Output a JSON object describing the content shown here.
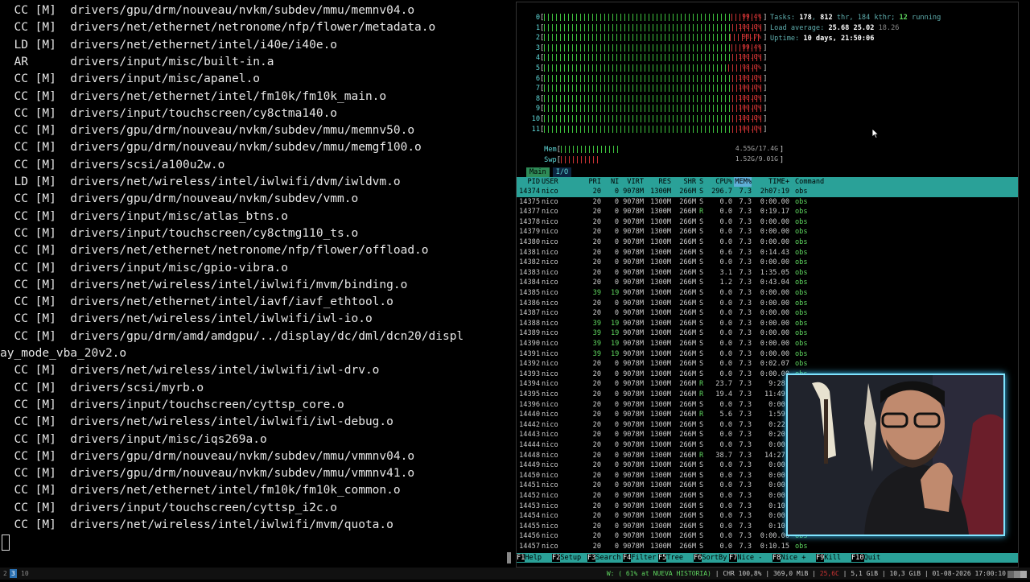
{
  "terminal": {
    "lines": [
      "  CC [M]  drivers/gpu/drm/nouveau/nvkm/subdev/mmu/memnv04.o",
      "  CC [M]  drivers/net/ethernet/netronome/nfp/flower/metadata.o",
      "  LD [M]  drivers/net/ethernet/intel/i40e/i40e.o",
      "  AR      drivers/input/misc/built-in.a",
      "  CC [M]  drivers/input/misc/apanel.o",
      "  CC [M]  drivers/net/ethernet/intel/fm10k/fm10k_main.o",
      "  CC [M]  drivers/input/touchscreen/cy8ctma140.o",
      "  CC [M]  drivers/gpu/drm/nouveau/nvkm/subdev/mmu/memnv50.o",
      "  CC [M]  drivers/gpu/drm/nouveau/nvkm/subdev/mmu/memgf100.o",
      "  CC [M]  drivers/scsi/a100u2w.o",
      "  LD [M]  drivers/net/wireless/intel/iwlwifi/dvm/iwldvm.o",
      "  CC [M]  drivers/gpu/drm/nouveau/nvkm/subdev/vmm.o",
      "  CC [M]  drivers/input/misc/atlas_btns.o",
      "  CC [M]  drivers/input/touchscreen/cy8ctmg110_ts.o",
      "  CC [M]  drivers/net/ethernet/netronome/nfp/flower/offload.o",
      "  CC [M]  drivers/input/misc/gpio-vibra.o",
      "  CC [M]  drivers/net/wireless/intel/iwlwifi/mvm/binding.o",
      "  CC [M]  drivers/net/ethernet/intel/iavf/iavf_ethtool.o",
      "  CC [M]  drivers/net/wireless/intel/iwlwifi/iwl-io.o",
      "  CC [M]  drivers/gpu/drm/amd/amdgpu/../display/dc/dml/dcn20/displ",
      "ay_mode_vba_20v2.o",
      "  CC [M]  drivers/net/wireless/intel/iwlwifi/iwl-drv.o",
      "  CC [M]  drivers/scsi/myrb.o",
      "  CC [M]  drivers/input/touchscreen/cyttsp_core.o",
      "  CC [M]  drivers/net/wireless/intel/iwlwifi/iwl-debug.o",
      "  CC [M]  drivers/input/misc/iqs269a.o",
      "  CC [M]  drivers/gpu/drm/nouveau/nvkm/subdev/mmu/vmmnv04.o",
      "  CC [M]  drivers/gpu/drm/nouveau/nvkm/subdev/mmu/vmmnv41.o",
      "  CC [M]  drivers/net/ethernet/intel/fm10k/fm10k_common.o",
      "  CC [M]  drivers/input/touchscreen/cyttsp_i2c.o",
      "  CC [M]  drivers/net/wireless/intel/iwlwifi/mvm/quota.o"
    ]
  },
  "htop": {
    "cpus": [
      {
        "idx": "0",
        "pct": "99.4%",
        "val": 99.4
      },
      {
        "idx": "1",
        "pct": "100.0%",
        "val": 100
      },
      {
        "idx": "2",
        "pct": "98.7%",
        "val": 98.7
      },
      {
        "idx": "3",
        "pct": "99.4%",
        "val": 99.4
      },
      {
        "idx": "4",
        "pct": "100.0%",
        "val": 100
      },
      {
        "idx": "5",
        "pct": "98.0%",
        "val": 98
      },
      {
        "idx": "6",
        "pct": "100.0%",
        "val": 100
      },
      {
        "idx": "7",
        "pct": "100.0%",
        "val": 100
      },
      {
        "idx": "8",
        "pct": "100.0%",
        "val": 100
      },
      {
        "idx": "9",
        "pct": "100.0%",
        "val": 100
      },
      {
        "idx": "10",
        "pct": "100.0%",
        "val": 100
      },
      {
        "idx": "11",
        "pct": "100.0%",
        "val": 100
      }
    ],
    "mem": {
      "label": "Mem",
      "value": "4.55G/17.4G",
      "fraction": 0.26
    },
    "swp": {
      "label": "Swp",
      "value": "1.52G/9.01G",
      "fraction": 0.17
    },
    "tasks": {
      "label": "Tasks:",
      "count": "178",
      "thr_val": "812",
      "thr_label": "thr,",
      "kthr": "184 kthr;",
      "running": "12",
      "running_label": "running"
    },
    "load": {
      "label": "Load average:",
      "v1": "25.68",
      "v5": "25.02",
      "v15": "18.26"
    },
    "uptime": {
      "label": "Uptime:",
      "value": "10 days, 21:50:06"
    },
    "tabs": [
      "Main",
      "I/O"
    ],
    "columns": [
      "PID",
      "USER",
      "PRI",
      "NI",
      "VIRT",
      "RES",
      "SHR",
      "S",
      "CPU%",
      "MEM%",
      "TIME+",
      "Command"
    ],
    "processes": [
      [
        "14374",
        "nico",
        "20",
        "0",
        "9078M",
        "1300M",
        "266M",
        "S",
        "296.7",
        "7.3",
        "2h07:19",
        "obs"
      ],
      [
        "14375",
        "nico",
        "20",
        "0",
        "9078M",
        "1300M",
        "266M",
        "S",
        "0.0",
        "7.3",
        "0:00.00",
        "obs"
      ],
      [
        "14377",
        "nico",
        "20",
        "0",
        "9078M",
        "1300M",
        "266M",
        "R",
        "0.0",
        "7.3",
        "0:19.17",
        "obs"
      ],
      [
        "14378",
        "nico",
        "20",
        "0",
        "9078M",
        "1300M",
        "266M",
        "S",
        "0.0",
        "7.3",
        "0:00.00",
        "obs"
      ],
      [
        "14379",
        "nico",
        "20",
        "0",
        "9078M",
        "1300M",
        "266M",
        "S",
        "0.0",
        "7.3",
        "0:00.00",
        "obs"
      ],
      [
        "14380",
        "nico",
        "20",
        "0",
        "9078M",
        "1300M",
        "266M",
        "S",
        "0.0",
        "7.3",
        "0:00.00",
        "obs"
      ],
      [
        "14381",
        "nico",
        "20",
        "0",
        "9078M",
        "1300M",
        "266M",
        "S",
        "0.6",
        "7.3",
        "0:14.43",
        "obs"
      ],
      [
        "14382",
        "nico",
        "20",
        "0",
        "9078M",
        "1300M",
        "266M",
        "S",
        "0.0",
        "7.3",
        "0:00.00",
        "obs"
      ],
      [
        "14383",
        "nico",
        "20",
        "0",
        "9078M",
        "1300M",
        "266M",
        "S",
        "3.1",
        "7.3",
        "1:35.05",
        "obs"
      ],
      [
        "14384",
        "nico",
        "20",
        "0",
        "9078M",
        "1300M",
        "266M",
        "S",
        "1.2",
        "7.3",
        "0:43.04",
        "obs"
      ],
      [
        "14385",
        "nico",
        "39",
        "19",
        "9078M",
        "1300M",
        "266M",
        "S",
        "0.0",
        "7.3",
        "0:00.00",
        "obs"
      ],
      [
        "14386",
        "nico",
        "20",
        "0",
        "9078M",
        "1300M",
        "266M",
        "S",
        "0.0",
        "7.3",
        "0:00.00",
        "obs"
      ],
      [
        "14387",
        "nico",
        "20",
        "0",
        "9078M",
        "1300M",
        "266M",
        "S",
        "0.0",
        "7.3",
        "0:00.00",
        "obs"
      ],
      [
        "14388",
        "nico",
        "39",
        "19",
        "9078M",
        "1300M",
        "266M",
        "S",
        "0.0",
        "7.3",
        "0:00.00",
        "obs"
      ],
      [
        "14389",
        "nico",
        "39",
        "19",
        "9078M",
        "1300M",
        "266M",
        "S",
        "0.0",
        "7.3",
        "0:00.00",
        "obs"
      ],
      [
        "14390",
        "nico",
        "39",
        "19",
        "9078M",
        "1300M",
        "266M",
        "S",
        "0.0",
        "7.3",
        "0:00.00",
        "obs"
      ],
      [
        "14391",
        "nico",
        "39",
        "19",
        "9078M",
        "1300M",
        "266M",
        "S",
        "0.0",
        "7.3",
        "0:00.00",
        "obs"
      ],
      [
        "14392",
        "nico",
        "20",
        "0",
        "9078M",
        "1300M",
        "266M",
        "S",
        "0.0",
        "7.3",
        "0:02.07",
        "obs"
      ],
      [
        "14393",
        "nico",
        "20",
        "0",
        "9078M",
        "1300M",
        "266M",
        "S",
        "0.0",
        "7.3",
        "0:00.00",
        "obs"
      ],
      [
        "14394",
        "nico",
        "20",
        "0",
        "9078M",
        "1300M",
        "266M",
        "R",
        "23.7",
        "7.3",
        "9:28.",
        "obs"
      ],
      [
        "14395",
        "nico",
        "20",
        "0",
        "9078M",
        "1300M",
        "266M",
        "R",
        "19.4",
        "7.3",
        "11:49.",
        "obs"
      ],
      [
        "14396",
        "nico",
        "20",
        "0",
        "9078M",
        "1300M",
        "266M",
        "S",
        "0.0",
        "7.3",
        "0:00.",
        "obs"
      ],
      [
        "14440",
        "nico",
        "20",
        "0",
        "9078M",
        "1300M",
        "266M",
        "R",
        "5.6",
        "7.3",
        "1:59.",
        "obs"
      ],
      [
        "14442",
        "nico",
        "20",
        "0",
        "9078M",
        "1300M",
        "266M",
        "S",
        "0.0",
        "7.3",
        "0:22.",
        "obs"
      ],
      [
        "14443",
        "nico",
        "20",
        "0",
        "9078M",
        "1300M",
        "266M",
        "S",
        "0.0",
        "7.3",
        "0:20.",
        "obs"
      ],
      [
        "14444",
        "nico",
        "20",
        "0",
        "9078M",
        "1300M",
        "266M",
        "S",
        "0.0",
        "7.3",
        "0:00.",
        "obs"
      ],
      [
        "14448",
        "nico",
        "20",
        "0",
        "9078M",
        "1300M",
        "266M",
        "R",
        "38.7",
        "7.3",
        "14:27.",
        "obs"
      ],
      [
        "14449",
        "nico",
        "20",
        "0",
        "9078M",
        "1300M",
        "266M",
        "S",
        "0.0",
        "7.3",
        "0:00.",
        "obs"
      ],
      [
        "14450",
        "nico",
        "20",
        "0",
        "9078M",
        "1300M",
        "266M",
        "S",
        "0.0",
        "7.3",
        "0:00.",
        "obs"
      ],
      [
        "14451",
        "nico",
        "20",
        "0",
        "9078M",
        "1300M",
        "266M",
        "S",
        "0.0",
        "7.3",
        "0:00.",
        "obs"
      ],
      [
        "14452",
        "nico",
        "20",
        "0",
        "9078M",
        "1300M",
        "266M",
        "S",
        "0.0",
        "7.3",
        "0:00.",
        "obs"
      ],
      [
        "14453",
        "nico",
        "20",
        "0",
        "9078M",
        "1300M",
        "266M",
        "S",
        "0.0",
        "7.3",
        "0:10.",
        "obs"
      ],
      [
        "14454",
        "nico",
        "20",
        "0",
        "9078M",
        "1300M",
        "266M",
        "S",
        "0.0",
        "7.3",
        "0:00.",
        "obs"
      ],
      [
        "14455",
        "nico",
        "20",
        "0",
        "9078M",
        "1300M",
        "266M",
        "S",
        "0.0",
        "7.3",
        "0:10.",
        "obs"
      ],
      [
        "14456",
        "nico",
        "20",
        "0",
        "9078M",
        "1300M",
        "266M",
        "S",
        "0.0",
        "7.3",
        "0:00.00",
        "obs"
      ],
      [
        "14457",
        "nico",
        "20",
        "0",
        "9078M",
        "1300M",
        "266M",
        "S",
        "0.0",
        "7.3",
        "0:10.15",
        "obs"
      ]
    ],
    "fkeys": [
      {
        "key": "F1",
        "label": "Help"
      },
      {
        "key": "F2",
        "label": "Setup"
      },
      {
        "key": "F3",
        "label": "Search"
      },
      {
        "key": "F4",
        "label": "Filter"
      },
      {
        "key": "F5",
        "label": "Tree"
      },
      {
        "key": "F6",
        "label": "SortBy"
      },
      {
        "key": "F7",
        "label": "Nice -"
      },
      {
        "key": "F8",
        "label": "Nice +"
      },
      {
        "key": "F9",
        "label": "Kill"
      },
      {
        "key": "F10",
        "label": "Quit"
      }
    ]
  },
  "statusbar": {
    "workspaces": [
      "2",
      "3",
      "10"
    ],
    "active_workspace": "3",
    "items": {
      "music": "W: ( 61% at NUEVA HISTORIA)",
      "cpu": "CHR 100,8%",
      "mem": "369,0 MiB",
      "temp": "25,6C",
      "ram": "5,1 GiB",
      "swap": "10,3 GiB",
      "date": "01-08-2026",
      "time": "17:00:10"
    }
  },
  "colors": {
    "accent": "#2aa198",
    "cpu_low": "#3ec43e",
    "cpu_high": "#cc3333",
    "webcam_border": "#7fe4ff"
  }
}
